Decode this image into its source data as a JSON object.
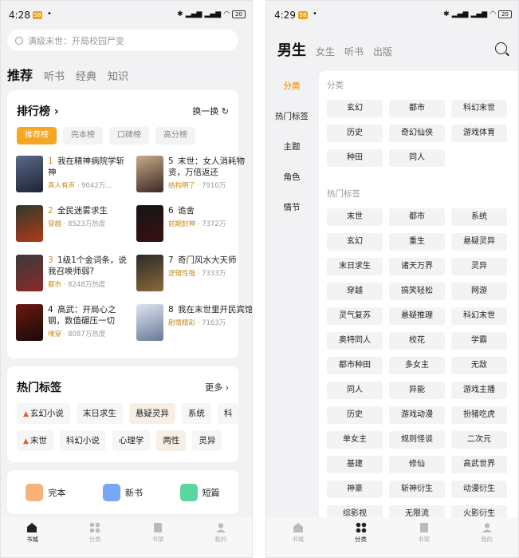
{
  "left": {
    "status": {
      "time": "4:28",
      "badge": "58",
      "battery": "20"
    },
    "search_placeholder": "满级末世：开局校园尸变",
    "nav": [
      "推荐",
      "听书",
      "经典",
      "知识"
    ],
    "ranking": {
      "title": "排行榜 ›",
      "refresh": "换一换 ↻",
      "chips": [
        "推荐榜",
        "完本榜",
        "口碑榜",
        "高分榜"
      ],
      "left_books": [
        {
          "num": "1",
          "title": "我在精神病院学斩神",
          "tag": "真人有声",
          "meta": " · 9042万..."
        },
        {
          "num": "2",
          "title": "全民迷雾求生",
          "tag": "穿越",
          "meta": " · 8523万热度"
        },
        {
          "num": "3",
          "title": "1级1个金词条，说我召唤师弱?",
          "tag": "都市",
          "meta": " · 8248万热度"
        },
        {
          "num": "4",
          "title": "高武：开局心之钢，数值碾压一切",
          "tag": "魂穿",
          "meta": " · 8087万热度"
        }
      ],
      "right_books": [
        {
          "num": "5",
          "title": "末世：女人消耗物资，万倍返还",
          "tag": "结构明了",
          "meta": " · 7910万"
        },
        {
          "num": "6",
          "title": "诡舍",
          "tag": "前期封神",
          "meta": " · 7372万"
        },
        {
          "num": "7",
          "title": "奇门风水大天师",
          "tag": "逻辑性强",
          "meta": " · 7333万"
        },
        {
          "num": "8",
          "title": "我在末世里开民宾馆",
          "tag": "剧情精彩",
          "meta": " · 7163万"
        }
      ]
    },
    "hot_tags": {
      "title": "热门标签",
      "more": "更多 ›",
      "row1": [
        "玄幻小说",
        "末日求生",
        "悬疑灵异",
        "系统",
        "科"
      ],
      "row2": [
        "末世",
        "科幻小说",
        "心理学",
        "两性",
        "灵异"
      ]
    },
    "quick": [
      "完本",
      "新书",
      "短篇"
    ],
    "tabs": [
      "书城",
      "分类",
      "书架",
      "我的"
    ]
  },
  "right": {
    "status": {
      "time": "4:29",
      "badge": "58",
      "battery": "20"
    },
    "gender": [
      "男生",
      "女生",
      "听书",
      "出版"
    ],
    "sidebar": [
      "分类",
      "热门标签",
      "主题",
      "角色",
      "情节"
    ],
    "section1": "分类",
    "cats": [
      "玄幻",
      "都市",
      "科幻末世",
      "历史",
      "奇幻仙侠",
      "游戏体育",
      "种田",
      "同人"
    ],
    "section2": "热门标签",
    "hot": [
      "末世",
      "都市",
      "系统",
      "玄幻",
      "重生",
      "悬疑灵异",
      "末日求生",
      "诸天万界",
      "灵异",
      "穿越",
      "搞笑轻松",
      "网游",
      "灵气复苏",
      "悬疑推理",
      "科幻末世",
      "奥特同人",
      "校花",
      "学霸",
      "都市种田",
      "多女主",
      "无敌",
      "同人",
      "异能",
      "游戏主播",
      "历史",
      "游戏动漫",
      "扮猪吃虎",
      "单女主",
      "规则怪谈",
      "二次元",
      "基建",
      "修仙",
      "高武世界",
      "神豪",
      "斩神衍生",
      "动漫衍生",
      "综影视",
      "无限流",
      "火影衍生"
    ],
    "tabs": [
      "书城",
      "分类",
      "书架",
      "我的"
    ]
  }
}
